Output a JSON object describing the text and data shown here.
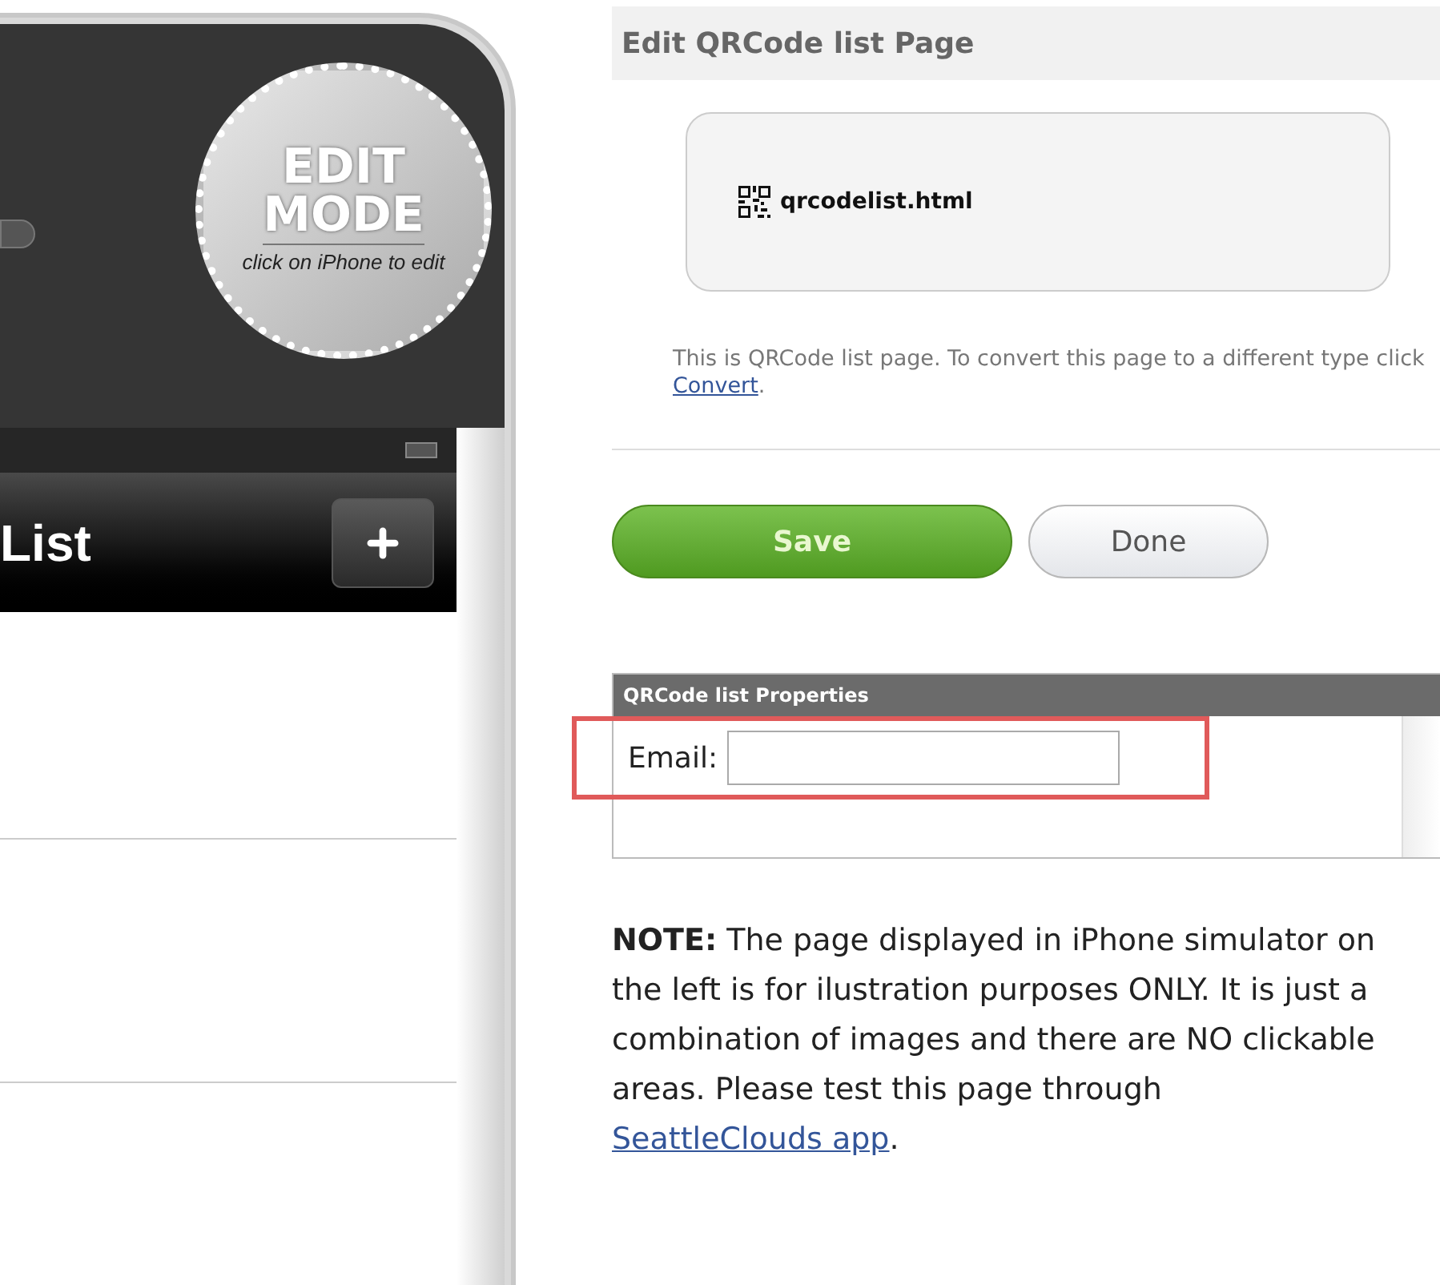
{
  "phone": {
    "badge": {
      "line_1": "EDIT",
      "line_2": "MODE",
      "caption": "click on iPhone to edit"
    },
    "nav_title": "List"
  },
  "header": {
    "title": "Edit QRCode list Page"
  },
  "page_card": {
    "file_name": "qrcodelist.html"
  },
  "info": {
    "text": "This is QRCode list page. To convert this page to a different type click",
    "link": "Convert",
    "end": "."
  },
  "buttons": [
    {
      "label": "Save",
      "kind": "primary"
    },
    {
      "label": "Done",
      "kind": "secondary"
    }
  ],
  "properties": {
    "title": "QRCode list Properties",
    "fields": [
      {
        "label": "Email:",
        "highlighted": true
      }
    ]
  },
  "note": {
    "text": "**NOTE:** The page displayed in iPhone simulator on the left is for ilustration purposes ONLY. It is just a combination of images and there are NO clickable areas. Please test this page through",
    "link": "SeattleClouds app",
    "end": "."
  }
}
